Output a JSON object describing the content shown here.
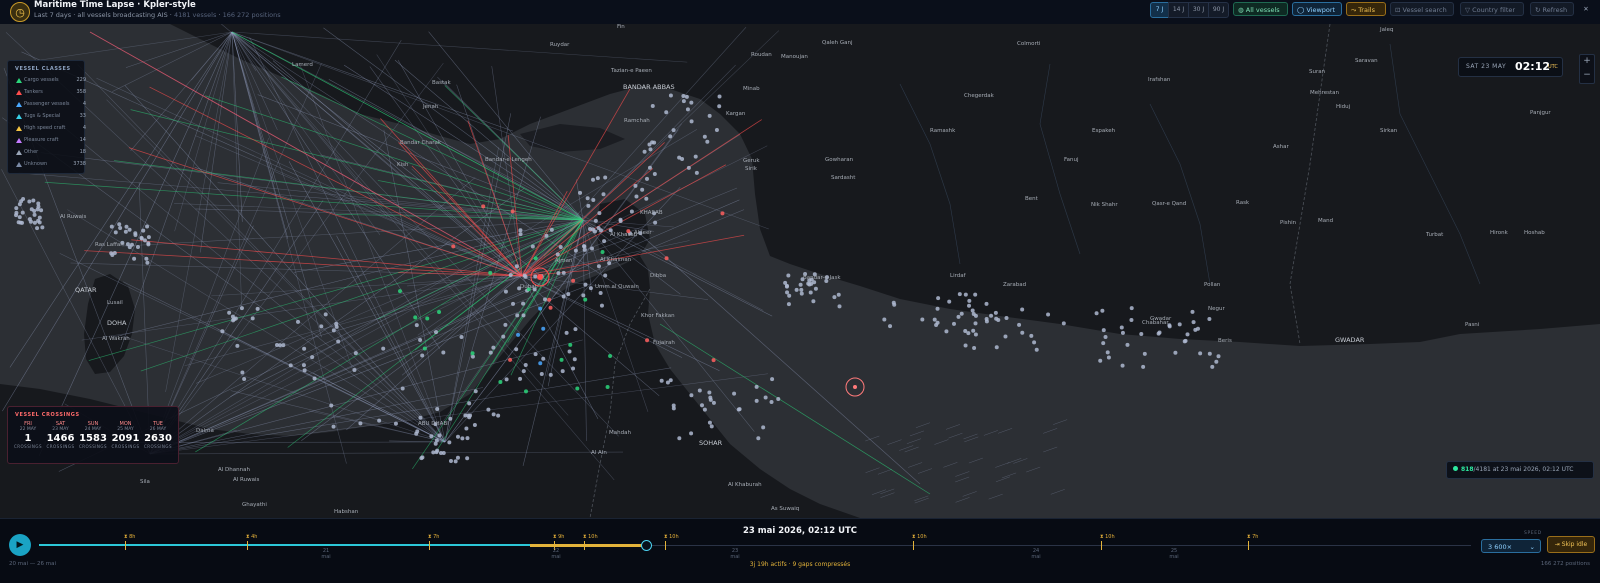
{
  "app": {
    "title": "Maritime Time Lapse · Kpler-style",
    "subtitle_prefix": "Last 7 days · all vessels broadcasting AIS ·",
    "vessel_count": "4181 vessels",
    "positions_count": "166 272 positions",
    "clock_icon": "clock-icon"
  },
  "toolbar": {
    "ranges": [
      "7 J",
      "14 J",
      "30 J",
      "90 J"
    ],
    "all_vessels": "All vessels",
    "viewport": "Viewport",
    "trails": "Trails",
    "vessel_search": "Vessel search",
    "country_filter": "Country filter",
    "refresh": "Refresh",
    "close": "✕"
  },
  "legend": {
    "title": "VESSEL CLASSES",
    "items": [
      {
        "label": "Cargo vessels",
        "count": "229",
        "color": "#2bd67b"
      },
      {
        "label": "Tankers",
        "count": "358",
        "color": "#ff4d4d"
      },
      {
        "label": "Passenger vessels",
        "count": "4",
        "color": "#4aa8ff"
      },
      {
        "label": "Tugs & Special",
        "count": "33",
        "color": "#38d0e6"
      },
      {
        "label": "High speed craft",
        "count": "4",
        "color": "#f5c542"
      },
      {
        "label": "Pleasure craft",
        "count": "14",
        "color": "#c47bff"
      },
      {
        "label": "Other",
        "count": "18",
        "color": "#9aa6b8"
      },
      {
        "label": "Unknown",
        "count": "3738",
        "color": "#7b8aa6"
      }
    ]
  },
  "crossings": {
    "title": "VESSEL CROSSINGS",
    "unit": "CROSSINGS",
    "days": [
      {
        "day": "FRI",
        "date": "22 MAY",
        "value": "1"
      },
      {
        "day": "SAT",
        "date": "23 MAY",
        "value": "1466"
      },
      {
        "day": "SUN",
        "date": "24 MAY",
        "value": "1583"
      },
      {
        "day": "MON",
        "date": "25 MAY",
        "value": "2091"
      },
      {
        "day": "TUE",
        "date": "26 MAY",
        "value": "2630"
      }
    ]
  },
  "clock": {
    "date": "SAT 23 MAY",
    "time": "02:12",
    "tz": "UTC"
  },
  "zoom": {
    "in": "+",
    "out": "−"
  },
  "active_status": {
    "count": "818",
    "rest": "/4181 at 23 mai 2026, 02:12 UTC"
  },
  "places": [
    {
      "name": "Ruydar",
      "big": false
    },
    {
      "name": "Lamerd",
      "big": false
    },
    {
      "name": "Bastak",
      "big": false
    },
    {
      "name": "Jenah",
      "big": false
    },
    {
      "name": "Bandar Charak",
      "big": false
    },
    {
      "name": "Kish",
      "big": false
    },
    {
      "name": "Bandar-e Lengeh",
      "big": false
    },
    {
      "name": "Al Ruwais",
      "big": false
    },
    {
      "name": "Ras Laffan",
      "big": false
    },
    {
      "name": "QATAR",
      "big": true
    },
    {
      "name": "Lusail",
      "big": false
    },
    {
      "name": "DOHA",
      "big": true
    },
    {
      "name": "Al Wakrah",
      "big": false
    },
    {
      "name": "Dalma",
      "big": false
    },
    {
      "name": "Al Dhannah",
      "big": false
    },
    {
      "name": "Al Ruwais",
      "big": false
    },
    {
      "name": "Sila",
      "big": false
    },
    {
      "name": "Ghayathi",
      "big": false
    },
    {
      "name": "Habshan",
      "big": false
    },
    {
      "name": "ABU DHABI",
      "big": false
    },
    {
      "name": "Mahdah",
      "big": false
    },
    {
      "name": "Al Ain",
      "big": false
    },
    {
      "name": "Al Khaburah",
      "big": false
    },
    {
      "name": "As Suwaiq",
      "big": false
    },
    {
      "name": "SOHAR",
      "big": true
    },
    {
      "name": "Fujairah",
      "big": false
    },
    {
      "name": "Khor Fakkan",
      "big": false
    },
    {
      "name": "Dibba",
      "big": false
    },
    {
      "name": "Al Khasab",
      "big": false
    },
    {
      "name": "KHASAB",
      "big": false
    },
    {
      "name": "Al Jeer",
      "big": false
    },
    {
      "name": "Ramchah",
      "big": false
    },
    {
      "name": "BANDAR ABBAS",
      "big": true
    },
    {
      "name": "Tazian-e Paeen",
      "big": false
    },
    {
      "name": "Fin",
      "big": false
    },
    {
      "name": "Roudan",
      "big": false
    },
    {
      "name": "Manoujan",
      "big": false
    },
    {
      "name": "Qaleh Ganj",
      "big": false
    },
    {
      "name": "Minab",
      "big": false
    },
    {
      "name": "Kargan",
      "big": false
    },
    {
      "name": "Geruk",
      "big": false
    },
    {
      "name": "Sirik",
      "big": false
    },
    {
      "name": "Gowharan",
      "big": false
    },
    {
      "name": "Sardasht",
      "big": false
    },
    {
      "name": "Bandar-e Jask",
      "big": false
    },
    {
      "name": "Lirdaf",
      "big": false
    },
    {
      "name": "Zarabad",
      "big": false
    },
    {
      "name": "Chegerdak",
      "big": false
    },
    {
      "name": "Ramashk",
      "big": false
    },
    {
      "name": "Colmorti",
      "big": false
    },
    {
      "name": "Bent",
      "big": false
    },
    {
      "name": "Fanuj",
      "big": false
    },
    {
      "name": "Espakeh",
      "big": false
    },
    {
      "name": "Nik Shahr",
      "big": false
    },
    {
      "name": "Qasr-e Qand",
      "big": false
    },
    {
      "name": "Irafshan",
      "big": false
    },
    {
      "name": "Ashar",
      "big": false
    },
    {
      "name": "Mehrestan",
      "big": false
    },
    {
      "name": "Hiduj",
      "big": false
    },
    {
      "name": "Sirkan",
      "big": false
    },
    {
      "name": "Suran",
      "big": false
    },
    {
      "name": "Saravan",
      "big": false
    },
    {
      "name": "Jaleq",
      "big": false
    },
    {
      "name": "Panjgur",
      "big": false
    },
    {
      "name": "Rask",
      "big": false
    },
    {
      "name": "Pishin",
      "big": false
    },
    {
      "name": "Mand",
      "big": false
    },
    {
      "name": "Turbat",
      "big": false
    },
    {
      "name": "Hironk",
      "big": false
    },
    {
      "name": "Hoshab",
      "big": false
    },
    {
      "name": "Pollan",
      "big": false
    },
    {
      "name": "Negur",
      "big": false
    },
    {
      "name": "Chabahar",
      "big": false
    },
    {
      "name": "Gwadar",
      "big": false
    },
    {
      "name": "Beris",
      "big": false
    },
    {
      "name": "GWADAR",
      "big": true
    },
    {
      "name": "Pasni",
      "big": false
    },
    {
      "name": "Ajman",
      "big": false
    },
    {
      "name": "Al Khaiman",
      "big": false
    },
    {
      "name": "Umm al Quwain",
      "big": false
    },
    {
      "name": "Dubai",
      "big": false
    }
  ],
  "timeline": {
    "current": "23 mai 2026, 02:12 UTC",
    "play_icon": "play-icon",
    "range_text": "20 mai — 26 mai",
    "active_text": "3j 19h actifs · 9 gaps compressés",
    "positions_text": "166 272 positions",
    "speed_label": "SPEED",
    "speed_value": "3 600×",
    "skip_idle": "Skip idle",
    "gaps": [
      "8h",
      "4h",
      "7h",
      "9h",
      "10h",
      "10h",
      "10h",
      "10h",
      "7h"
    ],
    "ticks": [
      {
        "d": "21",
        "m": "mai"
      },
      {
        "d": "22",
        "m": "mai"
      },
      {
        "d": "23",
        "m": "mai"
      },
      {
        "d": "24",
        "m": "mai"
      },
      {
        "d": "25",
        "m": "mai"
      }
    ]
  },
  "colors": {
    "cargo": "#2bd67b",
    "tanker": "#ff4d4d",
    "unknown": "#9aa6c8",
    "accent": "#2cc8d8",
    "gold": "#e3b33a"
  }
}
